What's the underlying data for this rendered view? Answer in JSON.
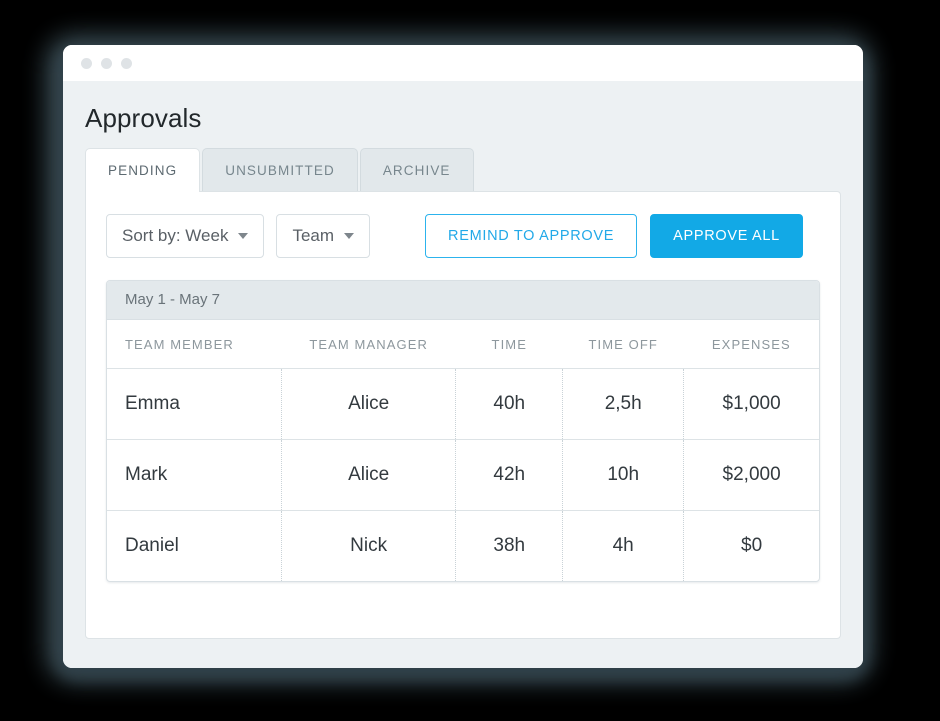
{
  "window": {
    "traffic_lights": [
      "dot-red",
      "dot-yellow",
      "dot-green"
    ]
  },
  "page": {
    "title": "Approvals"
  },
  "tabs": [
    {
      "label": "PENDING",
      "active": true
    },
    {
      "label": "UNSUBMITTED",
      "active": false
    },
    {
      "label": "ARCHIVE",
      "active": false
    }
  ],
  "toolbar": {
    "sort_select": "Sort by: Week",
    "team_select": "Team",
    "remind_button": "REMIND TO APPROVE",
    "approve_all_button": "APPROVE ALL"
  },
  "table": {
    "date_range": "May 1 - May 7",
    "columns": [
      "TEAM MEMBER",
      "TEAM MANAGER",
      "TIME",
      "TIME OFF",
      "EXPENSES"
    ],
    "rows": [
      {
        "team_member": "Emma",
        "team_manager": "Alice",
        "time": "40h",
        "time_off": "2,5h",
        "expenses": "$1,000"
      },
      {
        "team_member": "Mark",
        "team_manager": "Alice",
        "time": "42h",
        "time_off": "10h",
        "expenses": "$2,000"
      },
      {
        "team_member": "Daniel",
        "team_manager": "Nick",
        "time": "38h",
        "time_off": "4h",
        "expenses": "$0"
      }
    ]
  },
  "colors": {
    "accent_blue": "#12a9e6",
    "accent_blue_border": "#2cb3ed",
    "page_background": "#edf1f3",
    "panel_background": "#ffffff",
    "tab_inactive": "#e2e8eb",
    "band_background": "#e3e9ec",
    "text_primary": "#333a3f",
    "text_muted": "#8d979d",
    "shadow_slate": "#3d5058"
  }
}
